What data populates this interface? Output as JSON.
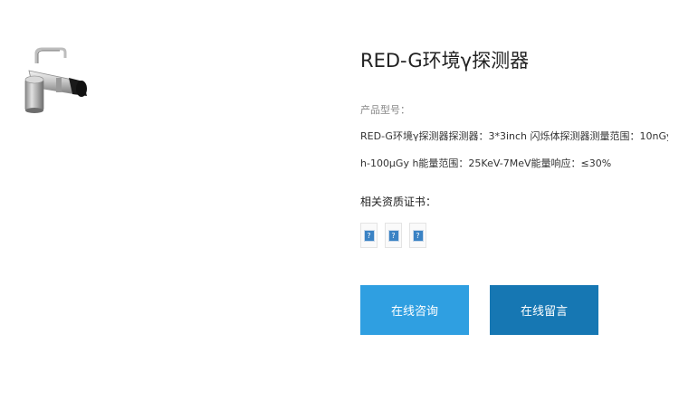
{
  "product": {
    "title": "RED-G环境γ探测器",
    "model_label": "产品型号：",
    "description_line1": "RED-G环境γ探测器探测器：3*3inch 闪烁体探测器测量范围：10nGy",
    "description_line2": "h-100μGy h能量范围：25KeV-7MeV能量响应：≤30%",
    "image_icon": "detector-product-photo"
  },
  "certificates": {
    "label": "相关资质证书：",
    "items": [
      "?",
      "?",
      "?"
    ],
    "icon": "broken-image-icon"
  },
  "actions": {
    "consult_label": "在线咨询",
    "message_label": "在线留言"
  },
  "colors": {
    "consult_button": "#2f9fe1",
    "message_button": "#1677b3"
  }
}
